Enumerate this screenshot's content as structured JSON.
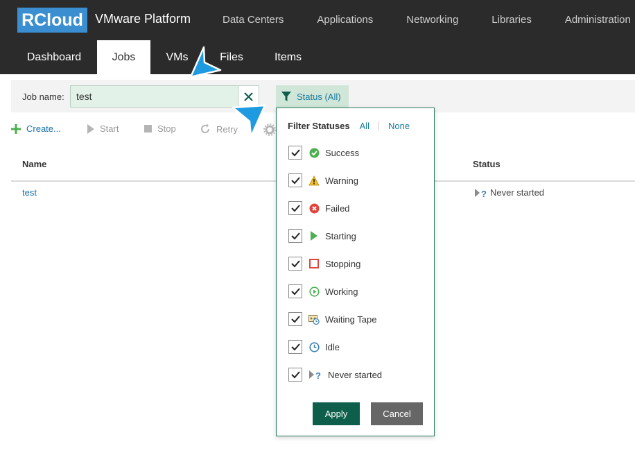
{
  "header": {
    "logo": "RCloud",
    "app_title": "VMware Platform",
    "nav": [
      "Data Centers",
      "Applications",
      "Networking",
      "Libraries",
      "Administration"
    ]
  },
  "subnav": {
    "tabs": [
      {
        "label": "Dashboard",
        "active": false
      },
      {
        "label": "Jobs",
        "active": true
      },
      {
        "label": "VMs",
        "active": false
      },
      {
        "label": "Files",
        "active": false
      },
      {
        "label": "Items",
        "active": false
      }
    ]
  },
  "filter": {
    "job_name_label": "Job name:",
    "job_name_value": "test",
    "status_button_label": "Status (All)"
  },
  "toolbar": {
    "create": "Create...",
    "start": "Start",
    "stop": "Stop",
    "retry": "Retry"
  },
  "table": {
    "columns": [
      "Name",
      "Status"
    ],
    "rows": [
      {
        "name": "test",
        "status": "Never started"
      }
    ]
  },
  "status_popup": {
    "title": "Filter Statuses",
    "all_link": "All",
    "none_link": "None",
    "items": [
      {
        "label": "Success",
        "checked": true,
        "icon": "success-icon"
      },
      {
        "label": "Warning",
        "checked": true,
        "icon": "warning-icon"
      },
      {
        "label": "Failed",
        "checked": true,
        "icon": "failed-icon"
      },
      {
        "label": "Starting",
        "checked": true,
        "icon": "starting-icon"
      },
      {
        "label": "Stopping",
        "checked": true,
        "icon": "stopping-icon"
      },
      {
        "label": "Working",
        "checked": true,
        "icon": "working-icon"
      },
      {
        "label": "Waiting Tape",
        "checked": true,
        "icon": "waiting-tape-icon"
      },
      {
        "label": "Idle",
        "checked": true,
        "icon": "idle-icon"
      },
      {
        "label": "Never started",
        "checked": true,
        "icon": "never-started-icon"
      }
    ],
    "apply_label": "Apply",
    "cancel_label": "Cancel"
  },
  "colors": {
    "header_bg": "#2b2b2b",
    "logo_bg": "#3b8fd1",
    "link": "#1a6fa8",
    "apply_bg": "#0d5f4b",
    "cancel_bg": "#666666",
    "filter_input_bg": "#e3f2e8",
    "status_button_bg": "#cfe6d8",
    "cursor": "#1e9be0"
  }
}
